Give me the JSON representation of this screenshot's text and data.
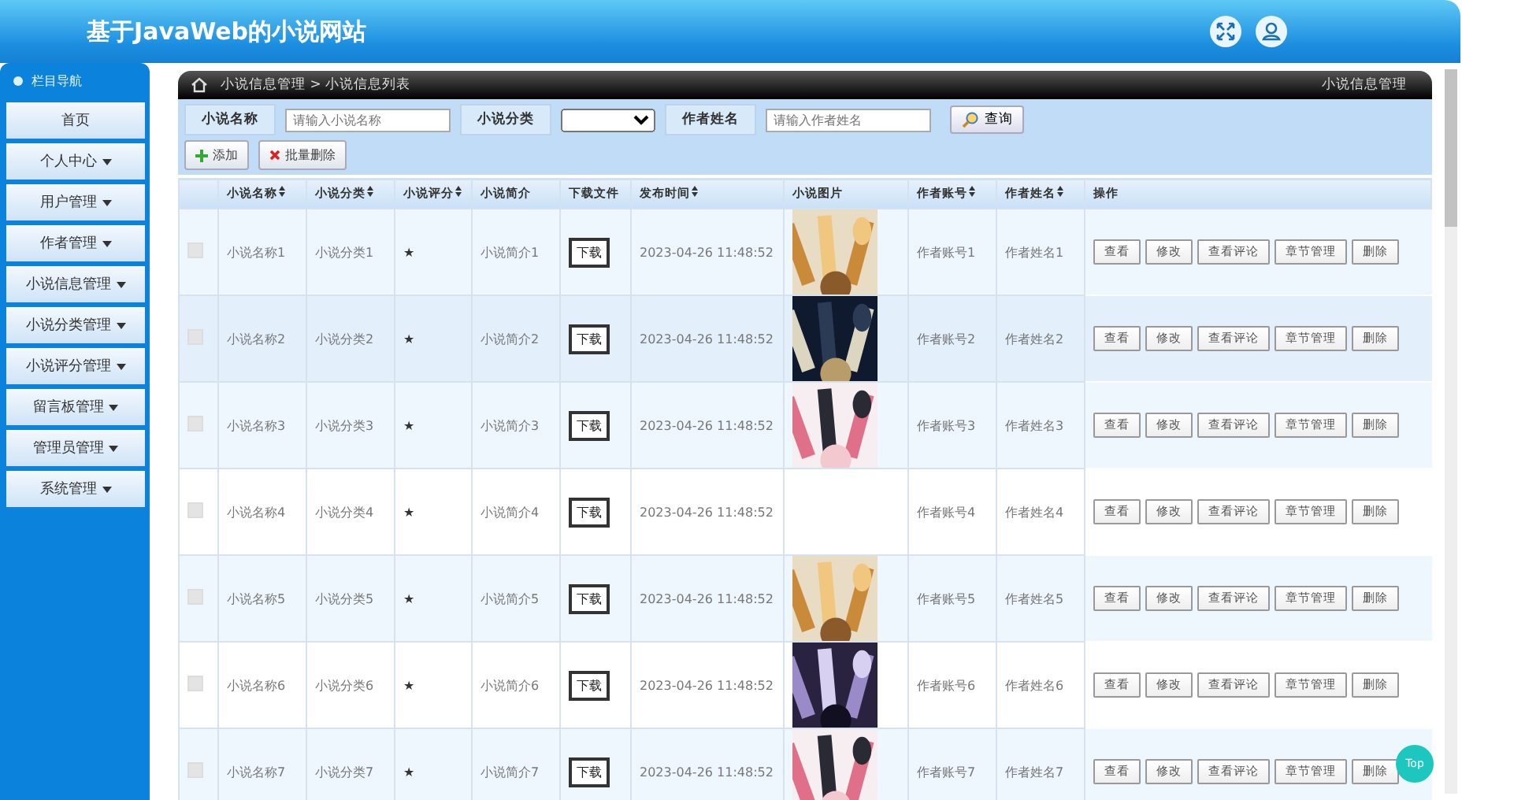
{
  "header": {
    "title": "基于JavaWeb的小说网站"
  },
  "sidebar": {
    "title": "栏目导航",
    "items": [
      {
        "label": "首页",
        "dropdown": false
      },
      {
        "label": "个人中心",
        "dropdown": true
      },
      {
        "label": "用户管理",
        "dropdown": true
      },
      {
        "label": "作者管理",
        "dropdown": true
      },
      {
        "label": "小说信息管理",
        "dropdown": true
      },
      {
        "label": "小说分类管理",
        "dropdown": true
      },
      {
        "label": "小说评分管理",
        "dropdown": true
      },
      {
        "label": "留言板管理",
        "dropdown": true
      },
      {
        "label": "管理员管理",
        "dropdown": true
      },
      {
        "label": "系统管理",
        "dropdown": true
      }
    ]
  },
  "breadcrumb": {
    "path": "小说信息管理 > 小说信息列表",
    "section": "小说信息管理"
  },
  "search": {
    "fields": [
      {
        "label": "小说名称",
        "kind": "text",
        "placeholder": "请输入小说名称"
      },
      {
        "label": "小说分类",
        "kind": "select"
      },
      {
        "label": "作者姓名",
        "kind": "text",
        "placeholder": "请输入作者姓名"
      }
    ],
    "button": "查询"
  },
  "actions": [
    {
      "label": "添加",
      "kind": "add"
    },
    {
      "label": "批量删除",
      "kind": "delete"
    }
  ],
  "table": {
    "columns": [
      {
        "label": "小说名称",
        "sortable": true
      },
      {
        "label": "小说分类",
        "sortable": true
      },
      {
        "label": "小说评分",
        "sortable": true
      },
      {
        "label": "小说简介",
        "sortable": false
      },
      {
        "label": "下载文件",
        "sortable": false
      },
      {
        "label": "发布时间",
        "sortable": true
      },
      {
        "label": "小说图片",
        "sortable": false
      },
      {
        "label": "作者账号",
        "sortable": true
      },
      {
        "label": "作者姓名",
        "sortable": true
      },
      {
        "label": "操作",
        "sortable": false
      }
    ],
    "rows": [
      {
        "checked": false,
        "name": "小说名称1",
        "category": "小说分类1",
        "rating": "★",
        "intro": "小说简介1",
        "download": "下载",
        "time": "2023-04-26 11:48:52",
        "account": "作者账号1",
        "author": "作者姓名1",
        "ops": [
          "查看",
          "修改",
          "查看评论",
          "章节管理",
          "删除"
        ]
      },
      {
        "checked": false,
        "name": "小说名称2",
        "category": "小说分类2",
        "rating": "★",
        "intro": "小说简介2",
        "download": "下载",
        "time": "2023-04-26 11:48:52",
        "account": "作者账号2",
        "author": "作者姓名2",
        "ops": [
          "查看",
          "修改",
          "查看评论",
          "章节管理",
          "删除"
        ]
      },
      {
        "checked": false,
        "name": "小说名称3",
        "category": "小说分类3",
        "rating": "★",
        "intro": "小说简介3",
        "download": "下载",
        "time": "2023-04-26 11:48:52",
        "account": "作者账号3",
        "author": "作者姓名3",
        "ops": [
          "查看",
          "修改",
          "查看评论",
          "章节管理",
          "删除"
        ]
      },
      {
        "checked": false,
        "name": "小说名称4",
        "category": "小说分类4",
        "rating": "★",
        "intro": "小说简介4",
        "download": "下载",
        "time": "2023-04-26 11:48:52",
        "account": "作者账号4",
        "author": "作者姓名4",
        "ops": [
          "查看",
          "修改",
          "查看评论",
          "章节管理",
          "删除"
        ]
      },
      {
        "checked": false,
        "name": "小说名称5",
        "category": "小说分类5",
        "rating": "★",
        "intro": "小说简介5",
        "download": "下载",
        "time": "2023-04-26 11:48:52",
        "account": "作者账号5",
        "author": "作者姓名5",
        "ops": [
          "查看",
          "修改",
          "查看评论",
          "章节管理",
          "删除"
        ]
      },
      {
        "checked": false,
        "name": "小说名称6",
        "category": "小说分类6",
        "rating": "★",
        "intro": "小说简介6",
        "download": "下载",
        "time": "2023-04-26 11:48:52",
        "account": "作者账号6",
        "author": "作者姓名6",
        "ops": [
          "查看",
          "修改",
          "查看评论",
          "章节管理",
          "删除"
        ]
      },
      {
        "checked": false,
        "name": "小说名称7",
        "category": "小说分类7",
        "rating": "★",
        "intro": "小说简介7",
        "download": "下载",
        "time": "2023-04-26 11:48:52",
        "account": "作者账号7",
        "author": "作者姓名7",
        "ops": [
          "查看",
          "修改",
          "查看评论",
          "章节管理",
          "删除"
        ]
      }
    ]
  },
  "top_button": "Top"
}
